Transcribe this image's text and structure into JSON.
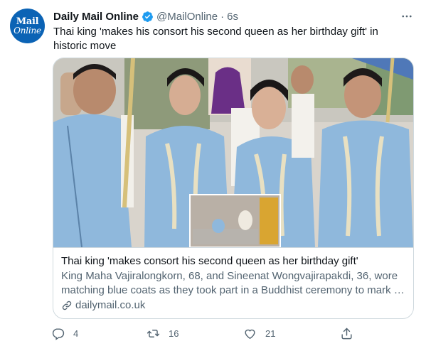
{
  "tweet": {
    "avatar": {
      "line1": "Mail",
      "line2": "Online",
      "color": "#0b63b5"
    },
    "author_name": "Daily Mail Online",
    "handle": "@MailOnline",
    "separator": "·",
    "time": "6s",
    "text": "Thai king 'makes his consort his second queen as her birthday gift' in historic move",
    "verified_color": "#1d9bf0",
    "more_icon": "ellipsis-icon"
  },
  "card": {
    "title": "Thai king 'makes consort his second queen as her birthday gift'",
    "description": "King Maha Vajiralongkorn, 68, and Sineenat Wongvajirapakdi, 36, wore matching blue coats as they took part in a Buddhist ceremony to mark …",
    "domain": "dailymail.co.uk",
    "link_icon": "link-icon"
  },
  "actions": {
    "reply_count": "4",
    "retweet_count": "16",
    "like_count": "21",
    "share_icon": "share-icon"
  },
  "colors": {
    "text": "#0f1419",
    "secondary": "#536471",
    "border": "#cfd9de",
    "coat_blue": "#8fb8dc"
  }
}
